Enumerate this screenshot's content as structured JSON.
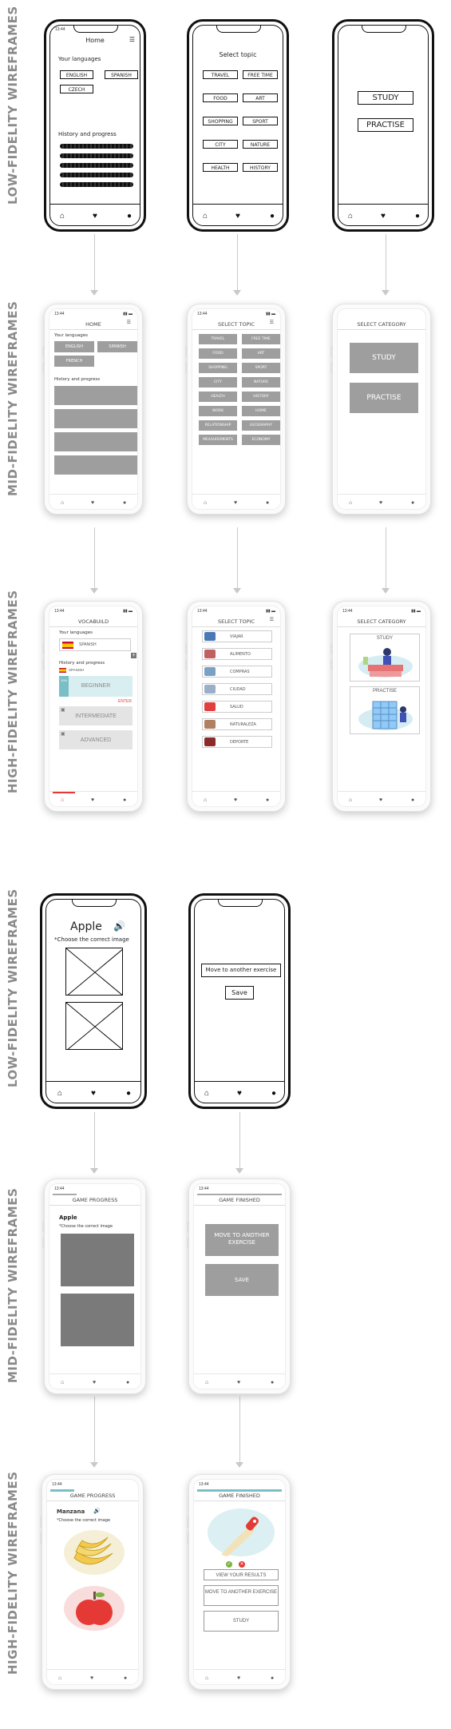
{
  "section_labels": {
    "row1": "LOW-FIDELITY WIREFRAMES",
    "row2": "MID-FIDELITY WIREFRAMES",
    "row3": "HIGH-FIDELITY WIREFRAMES",
    "row4": "LOW-FIDELITY WIREFRAMES",
    "row5": "MID-FIDELITY WIREFRAMES",
    "row6": "HIGH-FIDELITY WIREFRAMES"
  },
  "status": {
    "time": "13:44"
  },
  "lf_home": {
    "title": "Home",
    "languages_label": "Your languages",
    "languages": [
      "ENGLISH",
      "SPANISH",
      "CZECH"
    ],
    "history_label": "History and progress"
  },
  "lf_topic": {
    "title": "Select topic",
    "topics": [
      "TRAVEL",
      "FREE TIME",
      "FOOD",
      "ART",
      "SHOPPING",
      "SPORT",
      "CITY",
      "NATURE",
      "HEALTH",
      "HISTORY"
    ]
  },
  "lf_category": {
    "options": [
      "STUDY",
      "PRACTISE"
    ]
  },
  "mf_home": {
    "title": "HOME",
    "languages_label": "Your languages",
    "languages": [
      "ENGLISH",
      "SPANISH",
      "FRENCH"
    ],
    "history_label": "History and progress"
  },
  "mf_topic": {
    "title": "SELECT TOPIC",
    "topics": [
      "TRAVEL",
      "FREE TIME",
      "FOOD",
      "ART",
      "SHOPPING",
      "SPORT",
      "CITY",
      "NATURE",
      "HEALTH",
      "HISTORY",
      "WORK",
      "HOME",
      "RELATIONSHIP",
      "GEOGRAPHY",
      "MEASUREMENTS",
      "ECONOMY"
    ]
  },
  "mf_category": {
    "title": "SELECT CATEGORY",
    "options": [
      "STUDY",
      "PRACTISE"
    ]
  },
  "hf_home": {
    "title": "VOCABUILD",
    "languages_label": "Your languages",
    "language": "SPANISH",
    "add": "+",
    "history_label": "History and progress",
    "history_language": "SPANISH",
    "level_beginner": "BEGINNER",
    "progress": "10%",
    "enter": "ENTER",
    "level_intermediate": "INTERMEDIATE",
    "level_advanced": "ADVANCED"
  },
  "hf_topic": {
    "title": "SELECT TOPIC",
    "topics": [
      "VIAJAR",
      "ALIMENTO",
      "COMPRAS",
      "CIUDAD",
      "SALUD",
      "NATURALEZA",
      "DEPORTE"
    ]
  },
  "hf_category": {
    "title": "SELECT CATEGORY",
    "options": [
      "STUDY",
      "PRACTISE"
    ]
  },
  "lf_game": {
    "word": "Apple",
    "instruction": "*Choose the correct image"
  },
  "lf_finished": {
    "message": "Move to another exercise",
    "save": "Save"
  },
  "mf_game": {
    "title": "GAME PROGRESS",
    "word": "Apple",
    "instruction": "*Choose the correct image"
  },
  "mf_finished": {
    "title": "GAME FINISHED",
    "move": "MOVE TO ANOTHER EXERCISE",
    "save": "SAVE"
  },
  "hf_game": {
    "title": "GAME PROGRESS",
    "word": "Manzana",
    "instruction": "*Choose the correct image"
  },
  "hf_finished": {
    "title": "GAME FINISHED",
    "results": "VIEW YOUR RESULTS",
    "move": "MOVE TO ANOTHER EXERCISE",
    "study": "STUDY"
  },
  "icons": [
    "home-icon",
    "heart-icon",
    "user-icon",
    "filter-icon",
    "speaker-icon",
    "check-icon",
    "cross-icon",
    "lock-icon",
    "plus-icon"
  ],
  "colors": {
    "accent": "#e53935",
    "button_gray": "#9e9e9e",
    "label_gray": "#8a8a8a"
  }
}
